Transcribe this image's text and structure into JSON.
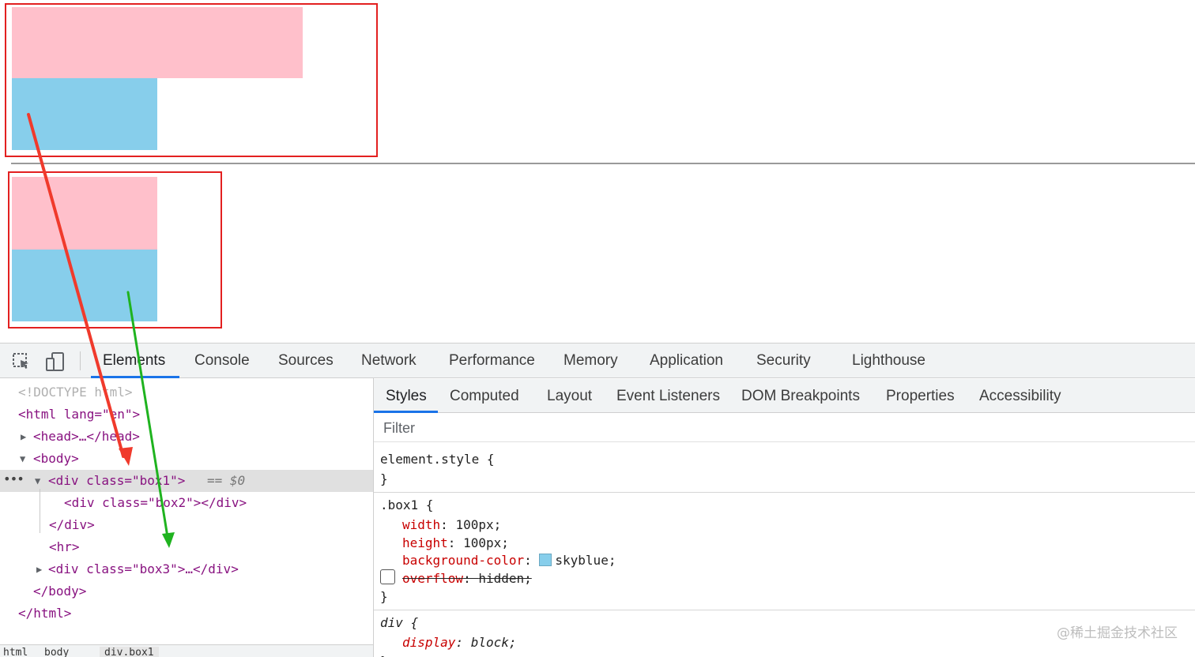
{
  "colors": {
    "annotation_red": "#e32020",
    "arrow_red": "#f03a2c",
    "arrow_green": "#1fb31f",
    "box_pink": "#ffc0cb",
    "box_skyblue": "#87ceeb",
    "active_tab": "#1a73e8"
  },
  "devtools": {
    "icons": [
      "inspect-element-icon",
      "device-toolbar-icon"
    ],
    "tabs": [
      "Elements",
      "Console",
      "Sources",
      "Network",
      "Performance",
      "Memory",
      "Application",
      "Security",
      "Lighthouse"
    ],
    "active_tab": "Elements"
  },
  "elements_tree": {
    "doctype": "<!DOCTYPE html>",
    "html_open": "<html lang=\"en\">",
    "head": "<head>…</head>",
    "body_open": "<body>",
    "box1_open": "<div class=\"box1\">",
    "selected_marker": "== $0",
    "box2": "<div class=\"box2\"></div>",
    "div_close": "</div>",
    "hr": "<hr>",
    "box3": "<div class=\"box3\">…</div>",
    "body_close": "</body>",
    "html_close": "</html>",
    "row_ellipsis": "•••",
    "breadcrumbs": [
      "html",
      "body",
      "div.box1"
    ]
  },
  "styles_pane": {
    "tabs": [
      "Styles",
      "Computed",
      "Layout",
      "Event Listeners",
      "DOM Breakpoints",
      "Properties",
      "Accessibility"
    ],
    "active_tab": "Styles",
    "filter_placeholder": "Filter",
    "element_style": {
      "selector": "element.style {",
      "close": "}"
    },
    "box1_rule": {
      "selector": ".box1 {",
      "declarations": [
        {
          "prop": "width",
          "value": "100px;"
        },
        {
          "prop": "height",
          "value": "100px;"
        },
        {
          "prop": "background-color",
          "value": "skyblue;",
          "swatch": "#87ceeb"
        },
        {
          "prop": "overflow",
          "value": "hidden;",
          "disabled": true
        }
      ],
      "close": "}"
    },
    "div_rule": {
      "selector": "div {",
      "declarations": [
        {
          "prop": "display",
          "value": "block;"
        }
      ],
      "close": "}"
    }
  },
  "watermark": "@稀土掘金技术社区"
}
